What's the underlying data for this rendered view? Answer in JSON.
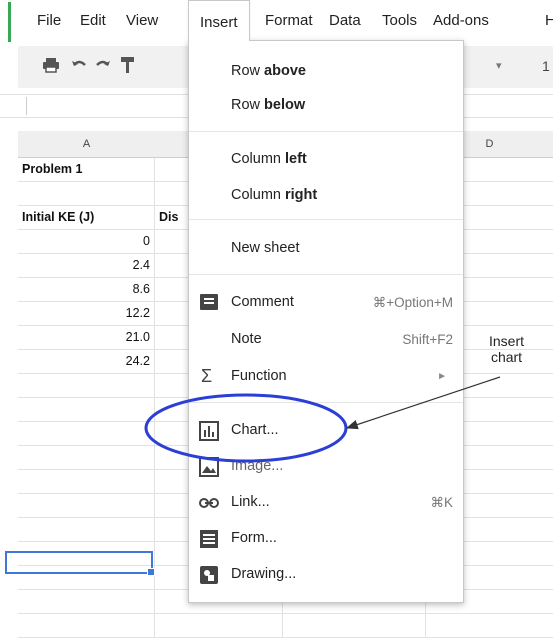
{
  "menubar": {
    "items": [
      "File",
      "Edit",
      "View",
      "Insert",
      "Format",
      "Data",
      "Tools",
      "Add-ons",
      "H"
    ]
  },
  "toolbar": {
    "caret": "▾",
    "font_size_partial": "1"
  },
  "grid": {
    "columns": [
      "A",
      "D"
    ],
    "cells": {
      "r1a": "Problem 1",
      "r3a": "Initial KE (J)",
      "r3b": "Dis",
      "v1": "0",
      "v2": "2.4",
      "v3": "8.6",
      "v4": "12.2",
      "v5": "21.0",
      "v6": "24.2"
    }
  },
  "insert_menu": {
    "row_above_prefix": "Row ",
    "row_above_bold": "above",
    "row_below_prefix": "Row ",
    "row_below_bold": "below",
    "col_left_prefix": "Column ",
    "col_left_bold": "left",
    "col_right_prefix": "Column ",
    "col_right_bold": "right",
    "new_sheet": "New sheet",
    "comment": "Comment",
    "comment_shortcut": "⌘+Option+M",
    "note": "Note",
    "note_shortcut": "Shift+F2",
    "function": "Function",
    "function_submenu": "►",
    "chart": "Chart...",
    "image": "Image...",
    "link": "Link...",
    "link_shortcut": "⌘K",
    "form": "Form...",
    "drawing": "Drawing..."
  },
  "annotation": {
    "line1": "Insert",
    "line2": "chart",
    "color": "#2b3fd6"
  }
}
